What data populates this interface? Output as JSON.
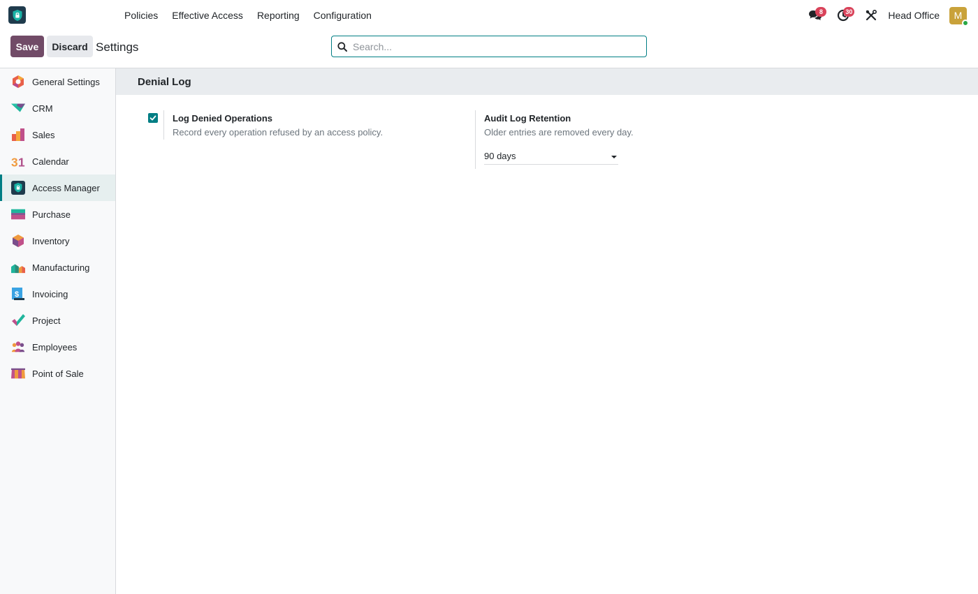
{
  "navbar": {
    "menu": [
      "Policies",
      "Effective Access",
      "Reporting",
      "Configuration"
    ],
    "messages_count": "8",
    "activities_count": "30",
    "company": "Head Office",
    "avatar_initial": "M"
  },
  "control": {
    "save_label": "Save",
    "discard_label": "Discard",
    "title": "Settings",
    "search_placeholder": "Search..."
  },
  "sidebar": {
    "items": [
      {
        "label": "General Settings",
        "icon": "general-settings-icon"
      },
      {
        "label": "CRM",
        "icon": "crm-icon"
      },
      {
        "label": "Sales",
        "icon": "sales-icon"
      },
      {
        "label": "Calendar",
        "icon": "calendar-icon"
      },
      {
        "label": "Access Manager",
        "icon": "access-manager-icon"
      },
      {
        "label": "Purchase",
        "icon": "purchase-icon"
      },
      {
        "label": "Inventory",
        "icon": "inventory-icon"
      },
      {
        "label": "Manufacturing",
        "icon": "manufacturing-icon"
      },
      {
        "label": "Invoicing",
        "icon": "invoicing-icon"
      },
      {
        "label": "Project",
        "icon": "project-icon"
      },
      {
        "label": "Employees",
        "icon": "employees-icon"
      },
      {
        "label": "Point of Sale",
        "icon": "point-of-sale-icon"
      }
    ],
    "active": "Access Manager"
  },
  "section": {
    "title": "Denial Log",
    "log_denied": {
      "label": "Log Denied Operations",
      "description": "Record every operation refused by an access policy.",
      "checked": true
    },
    "retention": {
      "label": "Audit Log Retention",
      "description": "Older entries are removed every day.",
      "value": "90 days"
    }
  },
  "colors": {
    "brand": "#714b67",
    "accent": "#017e84",
    "badge": "#d9435a"
  }
}
